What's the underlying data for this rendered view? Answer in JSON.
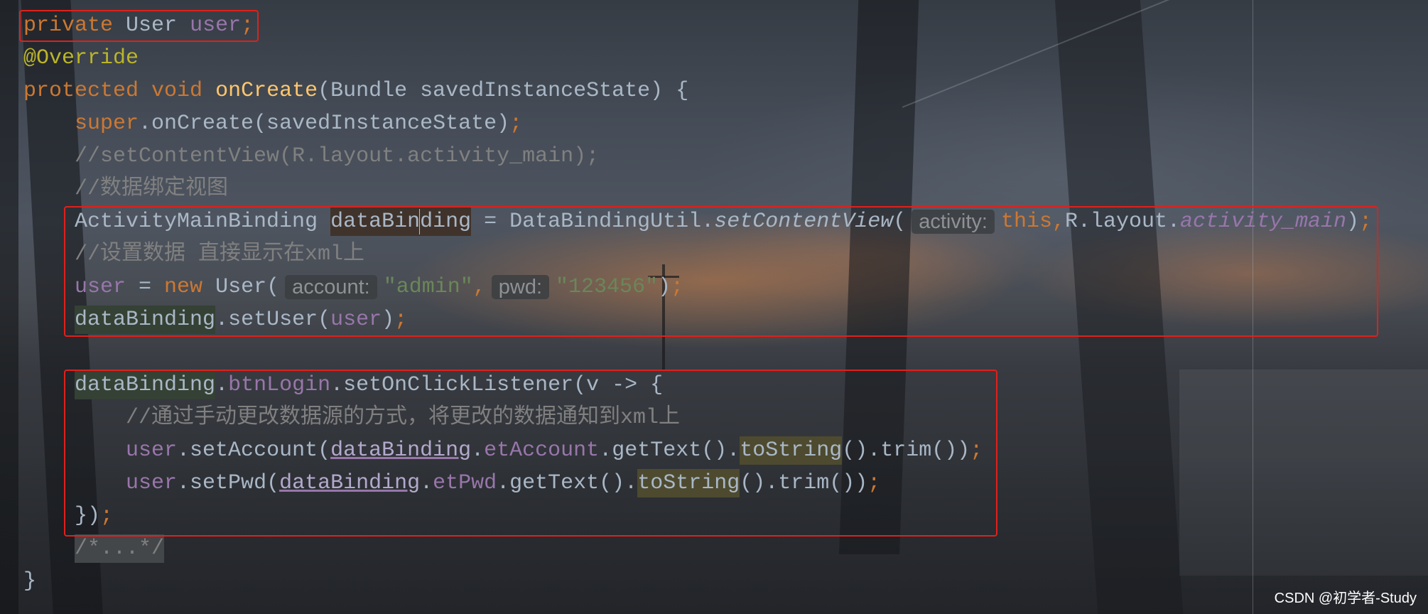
{
  "colors": {
    "text": "#A9B7C6",
    "hint_text": "#8E9195",
    "hint_bg": "#3B3E41D9",
    "caret": "#BBBBBB",
    "annotation_box": "#E0201B",
    "watermark": "#FFFFFF"
  },
  "editor": {
    "lines": [
      {
        "tokens": [
          {
            "t": "private",
            "c": "#CC7832"
          },
          {
            "t": " User "
          },
          {
            "t": "user",
            "c": "#9876AA"
          },
          {
            "t": ";",
            "c": "#CC7832"
          }
        ]
      },
      {
        "tokens": [
          {
            "t": "@Override",
            "c": "#BBB529"
          }
        ]
      },
      {
        "tokens": [
          {
            "t": "protected",
            "c": "#CC7832"
          },
          {
            "t": " "
          },
          {
            "t": "void",
            "c": "#CC7832"
          },
          {
            "t": " "
          },
          {
            "t": "onCreate",
            "c": "#FFC66D"
          },
          {
            "t": "(Bundle savedInstanceState) {"
          }
        ]
      },
      {
        "tokens": [
          {
            "t": "    "
          },
          {
            "t": "super",
            "c": "#CC7832"
          },
          {
            "t": ".onCreate(savedInstanceState)"
          },
          {
            "t": ";",
            "c": "#CC7832"
          }
        ]
      },
      {
        "tokens": [
          {
            "t": "    "
          },
          {
            "t": "//setContentView(R.layout.activity_main);",
            "c": "#808080"
          }
        ]
      },
      {
        "tokens": [
          {
            "t": "    "
          },
          {
            "t": "//数据绑定视图",
            "c": "#808080"
          }
        ]
      },
      {
        "tokens": [
          {
            "t": "    ActivityMainBinding "
          },
          {
            "t": "dataBin",
            "bg": "#40332B"
          },
          {
            "caret": true
          },
          {
            "t": "ding",
            "bg": "#40332B"
          },
          {
            "t": " = DataBindingUtil."
          },
          {
            "t": "setContentView",
            "italic": true
          },
          {
            "t": "("
          },
          {
            "t": "activity:",
            "hint": true
          },
          {
            "t": "this",
            "c": "#CC7832"
          },
          {
            "t": ",",
            "c": "#CC7832"
          },
          {
            "t": "R.layout."
          },
          {
            "t": "activity_main",
            "c": "#9876AA",
            "italic": true
          },
          {
            "t": ")"
          },
          {
            "t": ";",
            "c": "#CC7832"
          }
        ]
      },
      {
        "tokens": [
          {
            "t": "    "
          },
          {
            "t": "//设置数据 直接显示在xml上",
            "c": "#808080"
          }
        ]
      },
      {
        "tokens": [
          {
            "t": "    "
          },
          {
            "t": "user",
            "c": "#9876AA"
          },
          {
            "t": " = "
          },
          {
            "t": "new",
            "c": "#CC7832"
          },
          {
            "t": " User("
          },
          {
            "t": "account:",
            "hint": true
          },
          {
            "t": "\"admin\"",
            "c": "#6A8759"
          },
          {
            "t": ",",
            "c": "#CC7832"
          },
          {
            "t": "pwd:",
            "hint": true
          },
          {
            "t": "\"123456\"",
            "c": "#6A8759"
          },
          {
            "t": ")"
          },
          {
            "t": ";",
            "c": "#CC7832"
          }
        ]
      },
      {
        "tokens": [
          {
            "t": "    "
          },
          {
            "t": "dataBinding",
            "bg": "#344134"
          },
          {
            "t": ".setUser("
          },
          {
            "t": "user",
            "c": "#9876AA"
          },
          {
            "t": ")"
          },
          {
            "t": ";",
            "c": "#CC7832"
          }
        ]
      },
      {
        "tokens": []
      },
      {
        "tokens": [
          {
            "t": "    "
          },
          {
            "t": "dataBinding",
            "bg": "#344134"
          },
          {
            "t": "."
          },
          {
            "t": "btnLogin",
            "c": "#9876AA"
          },
          {
            "t": ".setOnClickListener(v -> {"
          }
        ]
      },
      {
        "tokens": [
          {
            "t": "        "
          },
          {
            "t": "//通过手动更改数据源的方式，将更改的数据通知到xml上",
            "c": "#808080"
          }
        ]
      },
      {
        "tokens": [
          {
            "t": "        "
          },
          {
            "t": "user",
            "c": "#9876AA"
          },
          {
            "t": ".setAccount("
          },
          {
            "t": "dataBinding",
            "c": "#B3A9CC",
            "underline": "#9876AA"
          },
          {
            "t": "."
          },
          {
            "t": "etAccount",
            "c": "#9876AA"
          },
          {
            "t": ".getText()."
          },
          {
            "t": "toString",
            "bg": "#4D4A2F"
          },
          {
            "t": "().trim())"
          },
          {
            "t": ";",
            "c": "#CC7832"
          }
        ]
      },
      {
        "tokens": [
          {
            "t": "        "
          },
          {
            "t": "user",
            "c": "#9876AA"
          },
          {
            "t": ".setPwd("
          },
          {
            "t": "dataBinding",
            "c": "#B3A9CC",
            "underline": "#9876AA"
          },
          {
            "t": "."
          },
          {
            "t": "etPwd",
            "c": "#9876AA"
          },
          {
            "t": ".getText()."
          },
          {
            "t": "toString",
            "bg": "#4D4A2F"
          },
          {
            "t": "().trim())"
          },
          {
            "t": ";",
            "c": "#CC7832"
          }
        ]
      },
      {
        "tokens": [
          {
            "t": "    "
          },
          {
            "t": "})"
          },
          {
            "t": ";",
            "c": "#CC7832"
          }
        ]
      },
      {
        "tokens": [
          {
            "t": "    "
          },
          {
            "t": "/*...*/",
            "c": "#808080",
            "bg": "#44474A"
          }
        ]
      },
      {
        "tokens": [
          {
            "t": "}"
          }
        ]
      }
    ]
  },
  "watermark": "CSDN @初学者-Study"
}
